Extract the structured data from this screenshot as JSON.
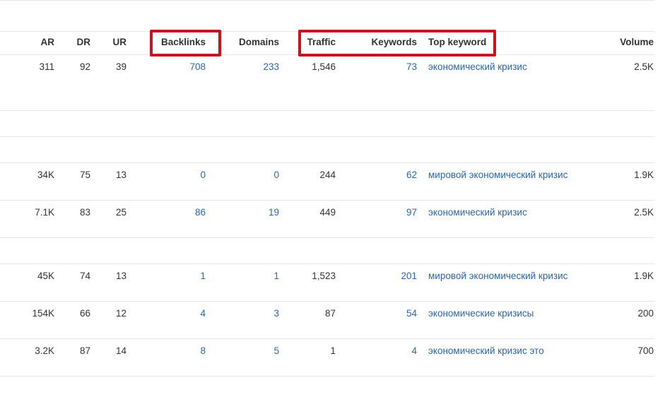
{
  "table": {
    "columns": {
      "ar": "AR",
      "dr": "DR",
      "ur": "UR",
      "backlinks": "Backlinks",
      "domains": "Domains",
      "traffic": "Traffic",
      "keywords": "Keywords",
      "top_keyword": "Top keyword",
      "volume": "Volume"
    },
    "rows": [
      {
        "ar": "311",
        "dr": "92",
        "ur": "39",
        "backlinks": "708",
        "domains": "233",
        "traffic": "1,546",
        "keywords": "73",
        "top_keyword": "экономический кризис",
        "volume": "2.5K"
      },
      {
        "ar": "34K",
        "dr": "75",
        "ur": "13",
        "backlinks": "0",
        "domains": "0",
        "traffic": "244",
        "keywords": "62",
        "top_keyword": "мировой экономический кризис",
        "volume": "1.9K"
      },
      {
        "ar": "7.1K",
        "dr": "83",
        "ur": "25",
        "backlinks": "86",
        "domains": "19",
        "traffic": "449",
        "keywords": "97",
        "top_keyword": "экономический кризис",
        "volume": "2.5K"
      },
      {
        "ar": "45K",
        "dr": "74",
        "ur": "13",
        "backlinks": "1",
        "domains": "1",
        "traffic": "1,523",
        "keywords": "201",
        "top_keyword": "мировой экономический кризис",
        "volume": "1.9K"
      },
      {
        "ar": "154K",
        "dr": "66",
        "ur": "12",
        "backlinks": "4",
        "domains": "3",
        "traffic": "87",
        "keywords": "54",
        "top_keyword": "экономические кризисы",
        "volume": "200"
      },
      {
        "ar": "3.2K",
        "dr": "87",
        "ur": "14",
        "backlinks": "8",
        "domains": "5",
        "traffic": "1",
        "keywords": "4",
        "top_keyword": "экономический кризис это",
        "volume": "700"
      }
    ]
  },
  "colors": {
    "link": "#2b66a8",
    "text": "#333333",
    "highlight_border": "#c4161c",
    "divider": "#e6e6e6"
  }
}
